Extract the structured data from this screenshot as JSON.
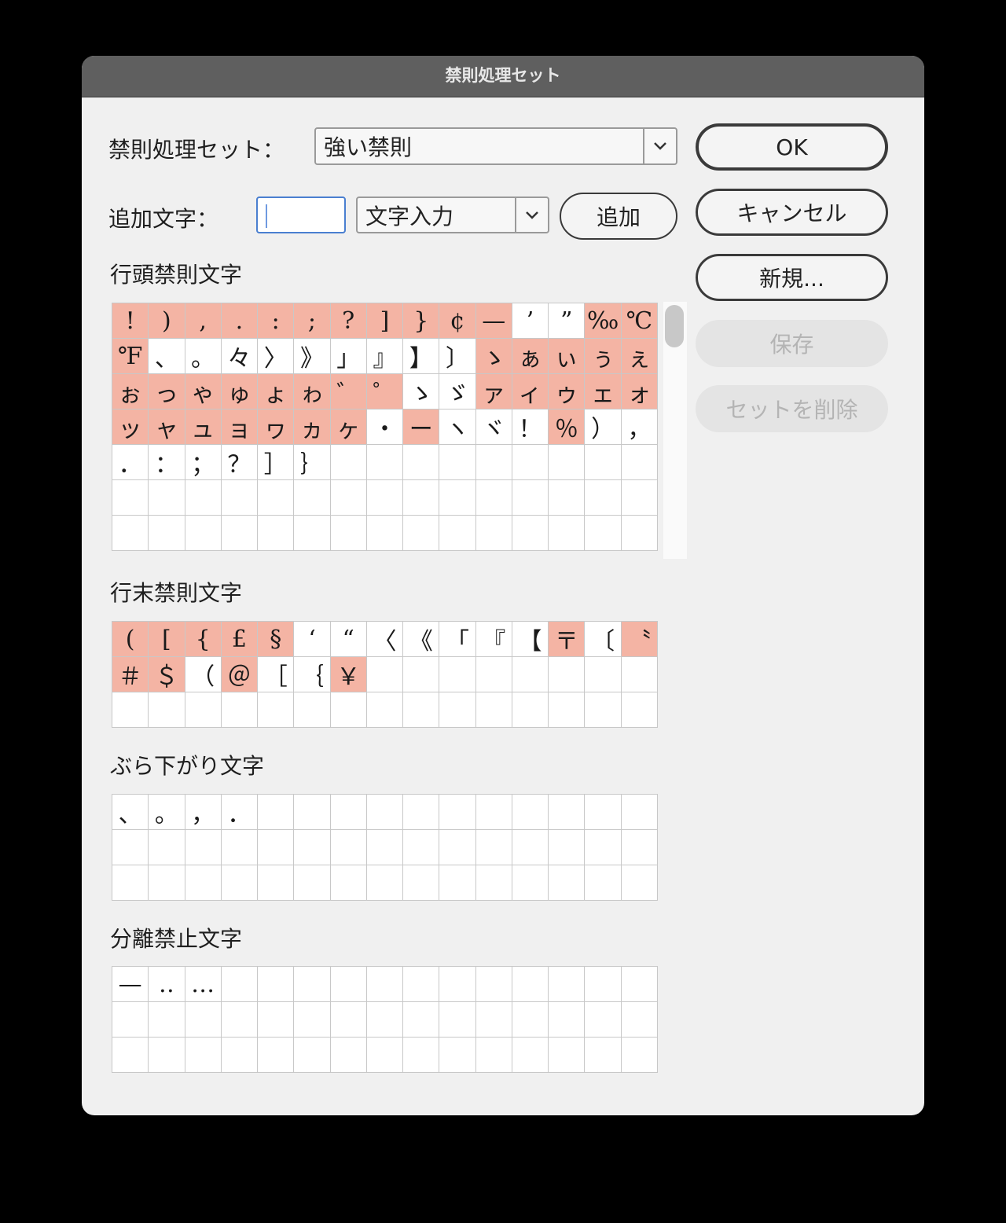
{
  "window": {
    "title": "禁則処理セット"
  },
  "form": {
    "set_label": "禁則処理セット：",
    "set_value": "強い禁則",
    "add_label": "追加文字：",
    "add_input_value": "",
    "input_mode_value": "文字入力",
    "add_button": "追加"
  },
  "buttons": {
    "ok": "OK",
    "cancel": "キャンセル",
    "new": "新規...",
    "save": "保存",
    "delete": "セットを削除"
  },
  "colors": {
    "highlight": "#f4b4a4"
  },
  "sections": {
    "line_start": {
      "label": "行頭禁則文字",
      "rows": 7,
      "cells": [
        {
          "c": "!",
          "hl": true
        },
        {
          "c": ")",
          "hl": true
        },
        {
          "c": ",",
          "hl": true
        },
        {
          "c": ".",
          "hl": true
        },
        {
          "c": ":",
          "hl": true
        },
        {
          "c": ";",
          "hl": true
        },
        {
          "c": "?",
          "hl": true
        },
        {
          "c": "]",
          "hl": true
        },
        {
          "c": "}",
          "hl": true
        },
        {
          "c": "¢",
          "hl": true
        },
        {
          "c": "—",
          "hl": true
        },
        {
          "c": "’",
          "hl": false
        },
        {
          "c": "”",
          "hl": false
        },
        {
          "c": "‰",
          "hl": true
        },
        {
          "c": "℃",
          "hl": true
        },
        {
          "c": "℉",
          "hl": true
        },
        {
          "c": "、",
          "hl": false
        },
        {
          "c": "。",
          "hl": false
        },
        {
          "c": "々",
          "hl": false
        },
        {
          "c": "〉",
          "hl": false
        },
        {
          "c": "》",
          "hl": false
        },
        {
          "c": "」",
          "hl": false
        },
        {
          "c": "』",
          "hl": false
        },
        {
          "c": "】",
          "hl": false
        },
        {
          "c": "〕",
          "hl": false
        },
        {
          "c": "ゝ",
          "hl": true
        },
        {
          "c": "ぁ",
          "hl": true
        },
        {
          "c": "ぃ",
          "hl": true
        },
        {
          "c": "ぅ",
          "hl": true
        },
        {
          "c": "ぇ",
          "hl": true
        },
        {
          "c": "ぉ",
          "hl": true
        },
        {
          "c": "っ",
          "hl": true
        },
        {
          "c": "ゃ",
          "hl": true
        },
        {
          "c": "ゅ",
          "hl": true
        },
        {
          "c": "ょ",
          "hl": true
        },
        {
          "c": "ゎ",
          "hl": true
        },
        {
          "c": "゛",
          "hl": true
        },
        {
          "c": "゜",
          "hl": true
        },
        {
          "c": "ゝ",
          "hl": false
        },
        {
          "c": "ゞ",
          "hl": false
        },
        {
          "c": "ァ",
          "hl": true
        },
        {
          "c": "ィ",
          "hl": true
        },
        {
          "c": "ゥ",
          "hl": true
        },
        {
          "c": "ェ",
          "hl": true
        },
        {
          "c": "ォ",
          "hl": true
        },
        {
          "c": "ッ",
          "hl": true
        },
        {
          "c": "ャ",
          "hl": true
        },
        {
          "c": "ュ",
          "hl": true
        },
        {
          "c": "ョ",
          "hl": true
        },
        {
          "c": "ヮ",
          "hl": true
        },
        {
          "c": "ヵ",
          "hl": true
        },
        {
          "c": "ヶ",
          "hl": true
        },
        {
          "c": "・",
          "hl": false
        },
        {
          "c": "ー",
          "hl": true
        },
        {
          "c": "ヽ",
          "hl": false
        },
        {
          "c": "ヾ",
          "hl": false
        },
        {
          "c": "！",
          "hl": false
        },
        {
          "c": "％",
          "hl": true
        },
        {
          "c": "）",
          "hl": false
        },
        {
          "c": "，",
          "hl": false
        },
        {
          "c": "．",
          "hl": false
        },
        {
          "c": "：",
          "hl": false
        },
        {
          "c": "；",
          "hl": false
        },
        {
          "c": "？",
          "hl": false
        },
        {
          "c": "］",
          "hl": false
        },
        {
          "c": "｝",
          "hl": false
        }
      ]
    },
    "line_end": {
      "label": "行末禁則文字",
      "rows": 3,
      "cells": [
        {
          "c": "(",
          "hl": true
        },
        {
          "c": "[",
          "hl": true
        },
        {
          "c": "{",
          "hl": true
        },
        {
          "c": "£",
          "hl": true
        },
        {
          "c": "§",
          "hl": true
        },
        {
          "c": "‘",
          "hl": false
        },
        {
          "c": "“",
          "hl": false
        },
        {
          "c": "〈",
          "hl": false
        },
        {
          "c": "《",
          "hl": false
        },
        {
          "c": "「",
          "hl": false
        },
        {
          "c": "『",
          "hl": false
        },
        {
          "c": "【",
          "hl": false
        },
        {
          "c": "〒",
          "hl": true
        },
        {
          "c": "〔",
          "hl": false
        },
        {
          "c": "〝",
          "hl": true
        },
        {
          "c": "＃",
          "hl": true
        },
        {
          "c": "＄",
          "hl": true
        },
        {
          "c": "（",
          "hl": false
        },
        {
          "c": "＠",
          "hl": true
        },
        {
          "c": "［",
          "hl": false
        },
        {
          "c": "｛",
          "hl": false
        },
        {
          "c": "￥",
          "hl": true
        }
      ]
    },
    "hanging": {
      "label": "ぶら下がり文字",
      "rows": 3,
      "cells": [
        {
          "c": "、",
          "hl": false
        },
        {
          "c": "。",
          "hl": false
        },
        {
          "c": "，",
          "hl": false
        },
        {
          "c": "．",
          "hl": false
        }
      ]
    },
    "no_break": {
      "label": "分離禁止文字",
      "rows": 3,
      "cells": [
        {
          "c": "—",
          "hl": false
        },
        {
          "c": "‥",
          "hl": false
        },
        {
          "c": "…",
          "hl": false
        }
      ]
    }
  }
}
